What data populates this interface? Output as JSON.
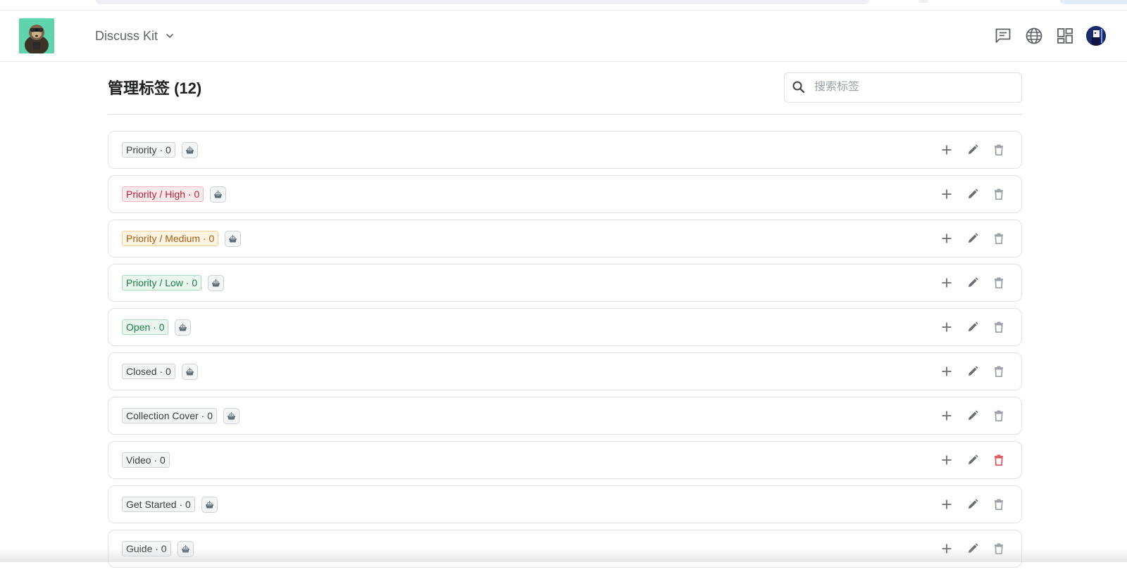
{
  "header": {
    "app_name": "Discuss Kit",
    "icons": [
      "chat-icon",
      "globe-icon",
      "grid-icon",
      "user-avatar"
    ]
  },
  "page": {
    "title": "管理标签 (12)",
    "search_placeholder": "搜索标签"
  },
  "colors": {
    "red_chip": "#b4233a",
    "orange_chip": "#a65d12",
    "green_chip": "#1e7d45",
    "delete_active": "#e0525d"
  },
  "tags": [
    {
      "label": "Priority · 0",
      "style": "gray",
      "bot": true,
      "delete_active": false
    },
    {
      "label": "Priority / High · 0",
      "style": "red",
      "bot": true,
      "delete_active": false
    },
    {
      "label": "Priority / Medium · 0",
      "style": "orange",
      "bot": true,
      "delete_active": false
    },
    {
      "label": "Priority / Low · 0",
      "style": "green",
      "bot": true,
      "delete_active": false
    },
    {
      "label": "Open · 0",
      "style": "green",
      "bot": true,
      "delete_active": false
    },
    {
      "label": "Closed · 0",
      "style": "gray",
      "bot": true,
      "delete_active": false
    },
    {
      "label": "Collection Cover · 0",
      "style": "gray",
      "bot": true,
      "delete_active": false
    },
    {
      "label": "Video · 0",
      "style": "gray",
      "bot": false,
      "delete_active": true
    },
    {
      "label": "Get Started · 0",
      "style": "gray",
      "bot": true,
      "delete_active": false
    },
    {
      "label": "Guide · 0",
      "style": "gray",
      "bot": true,
      "delete_active": false
    }
  ]
}
